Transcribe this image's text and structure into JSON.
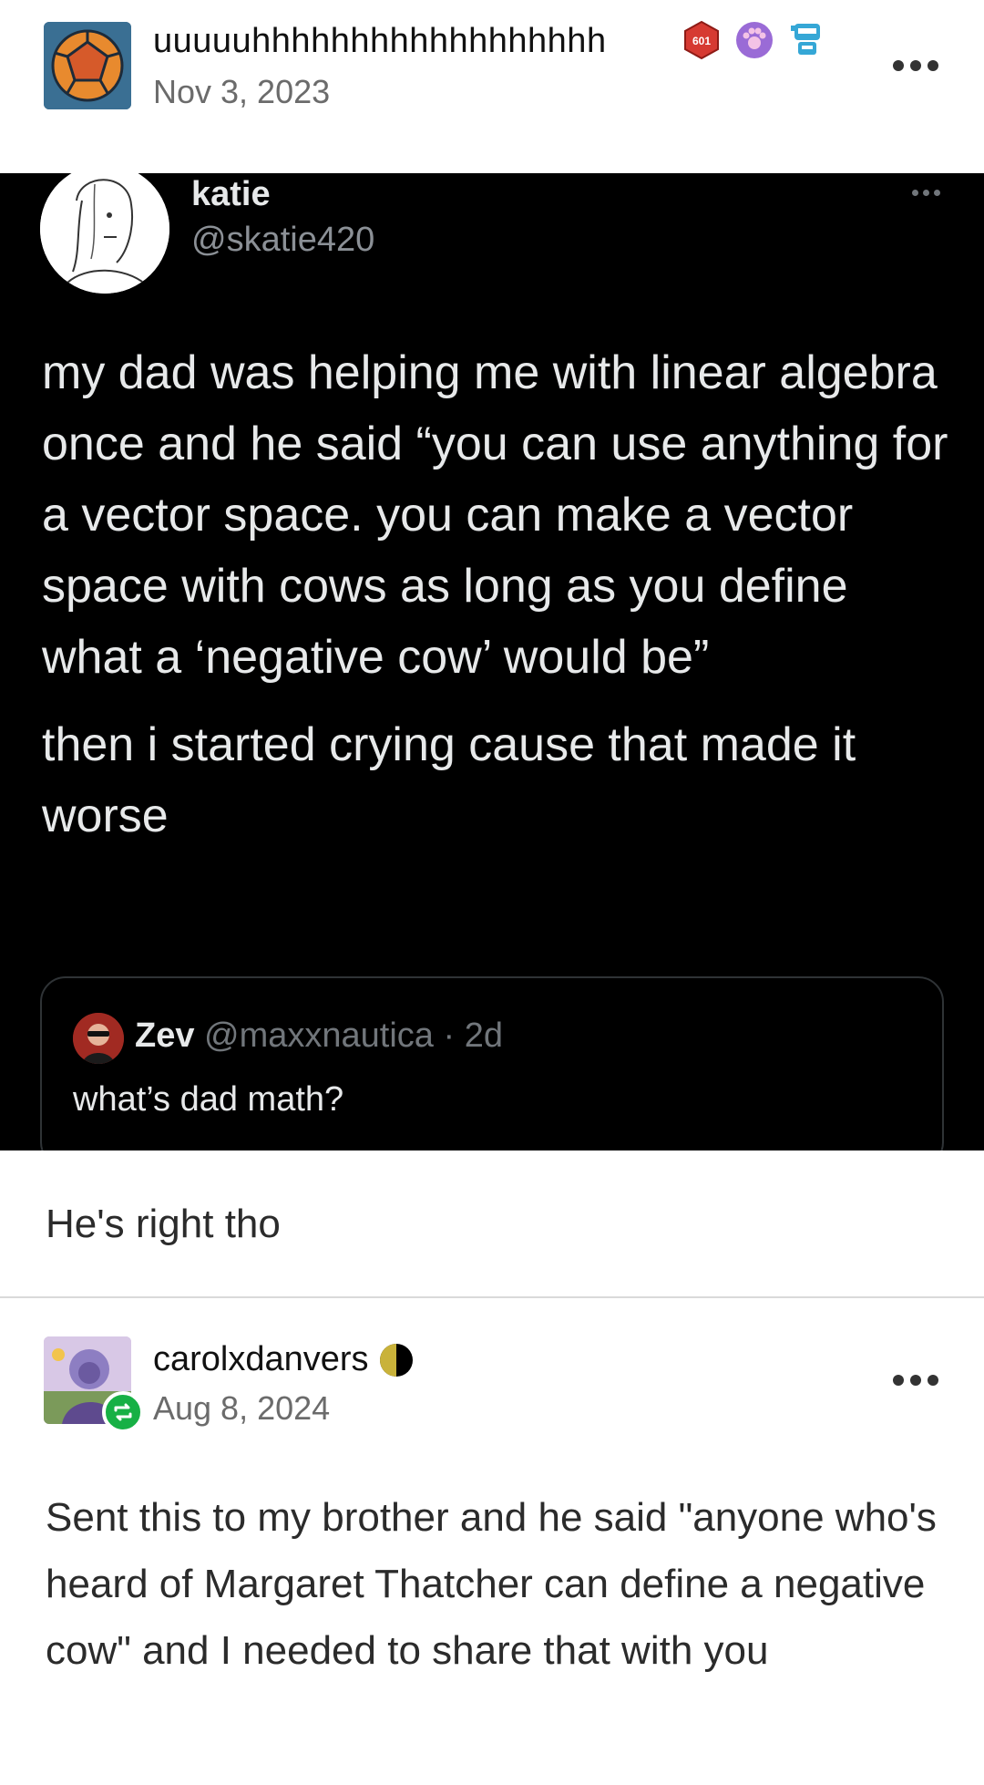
{
  "post": {
    "author": "uuuuuhhhhhhhhhhhhhhhhhh",
    "date": "Nov 3, 2023",
    "badge_text": "601",
    "badges": [
      "red-hexagon-badge",
      "paw-badge",
      "robot-badge"
    ],
    "comment": "He's right tho"
  },
  "tweet": {
    "name": "katie",
    "handle": "@skatie420",
    "paragraph1": "my dad was helping me with linear algebra once and he said “you can use anything for a vector space. you can make a vector space with cows as long as you define what a ‘negative cow’ would be”",
    "paragraph2": "then i started crying cause that made it worse",
    "quote": {
      "name": "Zev",
      "meta": "@maxxnautica · 2d",
      "text": "what’s dad math?"
    }
  },
  "reblog": {
    "author": "carolxdanvers",
    "date": "Aug 8, 2024",
    "badge": "moon-icon",
    "body": "Sent this to my brother and he said \"anyone who's heard of Margaret Thatcher can define a negative cow\" and I needed to share that with you"
  },
  "colors": {
    "tweet_bg": "#000000",
    "reblog_green": "#17b045",
    "muted_text": "#6b6b6b"
  }
}
